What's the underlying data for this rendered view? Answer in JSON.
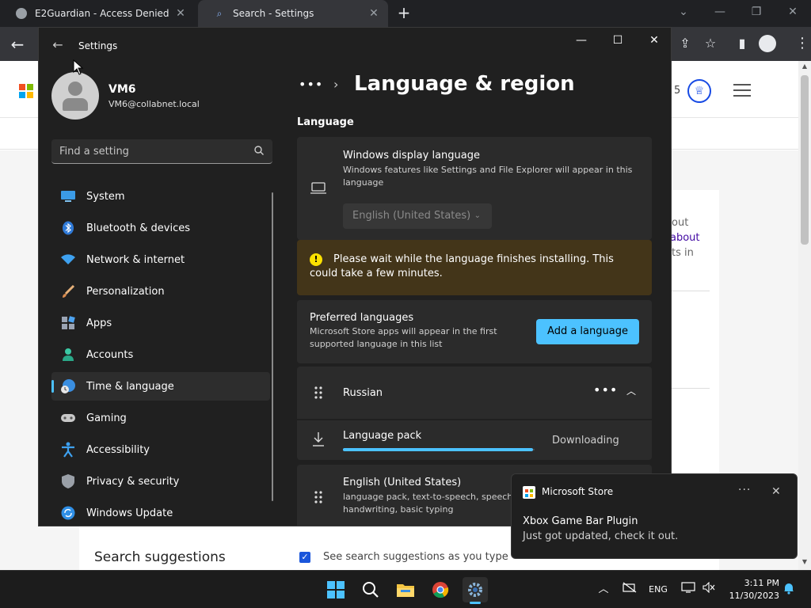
{
  "browser": {
    "tabs": [
      {
        "title": "E2Guardian - Access Denied",
        "icon": "globe-icon"
      },
      {
        "title": "Search - Settings",
        "icon": "bing-search-icon"
      }
    ],
    "new_tab_icon": "plus-icon"
  },
  "webpage": {
    "rewards_count": "5",
    "fragments": [
      "out",
      "about",
      "ts in"
    ],
    "search_suggestions_heading": "Search suggestions",
    "search_suggestions_checkbox": "See search suggestions as you type"
  },
  "settings": {
    "window_title": "Settings",
    "user": {
      "name": "VM6",
      "email": "VM6@collabnet.local"
    },
    "search_placeholder": "Find a setting",
    "nav": [
      {
        "label": "System",
        "icon": "monitor-icon"
      },
      {
        "label": "Bluetooth & devices",
        "icon": "bluetooth-icon"
      },
      {
        "label": "Network & internet",
        "icon": "wifi-icon"
      },
      {
        "label": "Personalization",
        "icon": "brush-icon"
      },
      {
        "label": "Apps",
        "icon": "apps-icon"
      },
      {
        "label": "Accounts",
        "icon": "person-icon"
      },
      {
        "label": "Time & language",
        "icon": "globe-clock-icon",
        "active": true
      },
      {
        "label": "Gaming",
        "icon": "gamepad-icon"
      },
      {
        "label": "Accessibility",
        "icon": "accessibility-icon"
      },
      {
        "label": "Privacy & security",
        "icon": "shield-icon"
      },
      {
        "label": "Windows Update",
        "icon": "update-icon"
      }
    ],
    "breadcrumb_ellipsis": "•••",
    "page_title": "Language & region",
    "section_heading": "Language",
    "display_language": {
      "title": "Windows display language",
      "description": "Windows features like Settings and File Explorer will appear in this language",
      "selected": "English (United States)"
    },
    "warning": "Please wait while the language finishes installing. This could take a few minutes.",
    "preferred_languages": {
      "title": "Preferred languages",
      "description": "Microsoft Store apps will appear in the first supported language in this list",
      "button": "Add a language"
    },
    "languages": [
      {
        "name": "Russian",
        "expanded": true,
        "pack_label": "Language pack",
        "pack_status": "Downloading",
        "progress": 0.99
      },
      {
        "name": "English (United States)",
        "features": "language pack, text-to-speech, speech handwriting, basic typing"
      }
    ]
  },
  "toast": {
    "app": "Microsoft Store",
    "title": "Xbox Game Bar Plugin",
    "body": "Just got updated, check it out."
  },
  "taskbar": {
    "apps": [
      "windows-start-icon",
      "search-icon",
      "file-explorer-icon",
      "chrome-icon",
      "settings-gear-icon"
    ],
    "language": "ENG",
    "time": "3:11 PM",
    "date": "11/30/2023"
  },
  "colors": {
    "accent": "#4cc2ff",
    "warning_bg": "#433519",
    "settings_bg": "#202020",
    "card_bg": "#2b2b2b"
  }
}
